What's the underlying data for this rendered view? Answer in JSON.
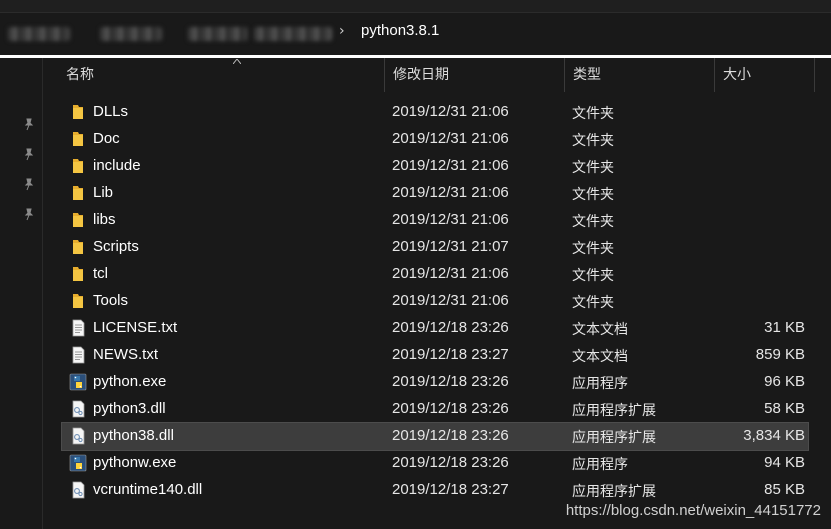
{
  "address": {
    "current_folder": "python3.8.1",
    "separator": "›"
  },
  "columns": {
    "name": "名称",
    "modified": "修改日期",
    "type": "类型",
    "size": "大小"
  },
  "files": [
    {
      "name": "DLLs",
      "modified": "2019/12/31 21:06",
      "type": "文件夹",
      "size": "",
      "icon": "folder-icon"
    },
    {
      "name": "Doc",
      "modified": "2019/12/31 21:06",
      "type": "文件夹",
      "size": "",
      "icon": "folder-icon"
    },
    {
      "name": "include",
      "modified": "2019/12/31 21:06",
      "type": "文件夹",
      "size": "",
      "icon": "folder-icon"
    },
    {
      "name": "Lib",
      "modified": "2019/12/31 21:06",
      "type": "文件夹",
      "size": "",
      "icon": "folder-icon"
    },
    {
      "name": "libs",
      "modified": "2019/12/31 21:06",
      "type": "文件夹",
      "size": "",
      "icon": "folder-icon"
    },
    {
      "name": "Scripts",
      "modified": "2019/12/31 21:07",
      "type": "文件夹",
      "size": "",
      "icon": "folder-icon"
    },
    {
      "name": "tcl",
      "modified": "2019/12/31 21:06",
      "type": "文件夹",
      "size": "",
      "icon": "folder-icon"
    },
    {
      "name": "Tools",
      "modified": "2019/12/31 21:06",
      "type": "文件夹",
      "size": "",
      "icon": "folder-icon"
    },
    {
      "name": "LICENSE.txt",
      "modified": "2019/12/18 23:26",
      "type": "文本文档",
      "size": "31 KB",
      "icon": "text-file-icon"
    },
    {
      "name": "NEWS.txt",
      "modified": "2019/12/18 23:27",
      "type": "文本文档",
      "size": "859 KB",
      "icon": "text-file-icon"
    },
    {
      "name": "python.exe",
      "modified": "2019/12/18 23:26",
      "type": "应用程序",
      "size": "96 KB",
      "icon": "python-exe-icon"
    },
    {
      "name": "python3.dll",
      "modified": "2019/12/18 23:26",
      "type": "应用程序扩展",
      "size": "58 KB",
      "icon": "dll-file-icon"
    },
    {
      "name": "python38.dll",
      "modified": "2019/12/18 23:26",
      "type": "应用程序扩展",
      "size": "3,834 KB",
      "icon": "dll-file-icon",
      "selected": true
    },
    {
      "name": "pythonw.exe",
      "modified": "2019/12/18 23:26",
      "type": "应用程序",
      "size": "94 KB",
      "icon": "python-exe-icon"
    },
    {
      "name": "vcruntime140.dll",
      "modified": "2019/12/18 23:27",
      "type": "应用程序扩展",
      "size": "85 KB",
      "icon": "dll-file-icon"
    }
  ],
  "watermark": "https://blog.csdn.net/weixin_44151772",
  "colors": {
    "background": "#191919",
    "selected_row": "#3d3d3d",
    "folder": "#f4c542"
  }
}
